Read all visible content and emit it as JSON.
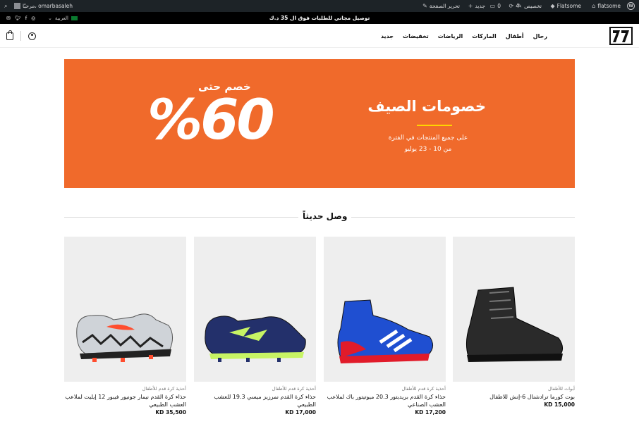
{
  "admin_bar": {
    "site_name": "flatsome",
    "theme": "Flatsome",
    "customize": "تخصيص",
    "updates": "4",
    "comments": "0",
    "new": "جديد",
    "edit_page": "تحرير الصفحة",
    "greeting": "مرحبًا، omarbasaleh"
  },
  "topbar": {
    "promo": "توصيل مجاني للطلبات فوق ال 35 د.ك",
    "language": "العربية"
  },
  "nav": {
    "items": [
      "رجال",
      "أطفال",
      "الماركات",
      "الرياضات",
      "تخفيضات",
      "جديد"
    ]
  },
  "logo_text": "77",
  "banner": {
    "title": "خصومات الصيف",
    "subtitle_line1": "على جميع المنتجات في الفترة",
    "subtitle_line2": "من 10 - 23 يوليو",
    "upto": "خصم حتى",
    "percent": "%60",
    "color": "#f06a2b"
  },
  "section": {
    "title": "وصل حديثاً"
  },
  "products": [
    {
      "category": "أحذية كرة قدم للأطفال",
      "name": "حذاء كرة القدم نيمار جونيور فيبور 12 إيليت لملاعب العشب الطبيعي",
      "price": "35,500 KD",
      "image": "grey-orange-football-boot"
    },
    {
      "category": "أحذية كرة قدم للأطفال",
      "name": "حذاء كرة القدم نمرزيز ميسي 19.3 للعشب الطبيعي",
      "price": "17,000 KD",
      "image": "navy-football-boot"
    },
    {
      "category": "أحذية كرة قدم للأطفال",
      "name": "حذاء كرة القدم بريديتور 20.3 ميوتيتور باك لملاعب العشب الصناعي",
      "price": "17,200 KD",
      "image": "blue-red-predator-boot"
    },
    {
      "category": "أبوات للأطفال",
      "name": "بوت كورما ترادشنال 6-إنش للاطفال",
      "price": "15,000 KD",
      "image": "black-leather-boot"
    }
  ]
}
